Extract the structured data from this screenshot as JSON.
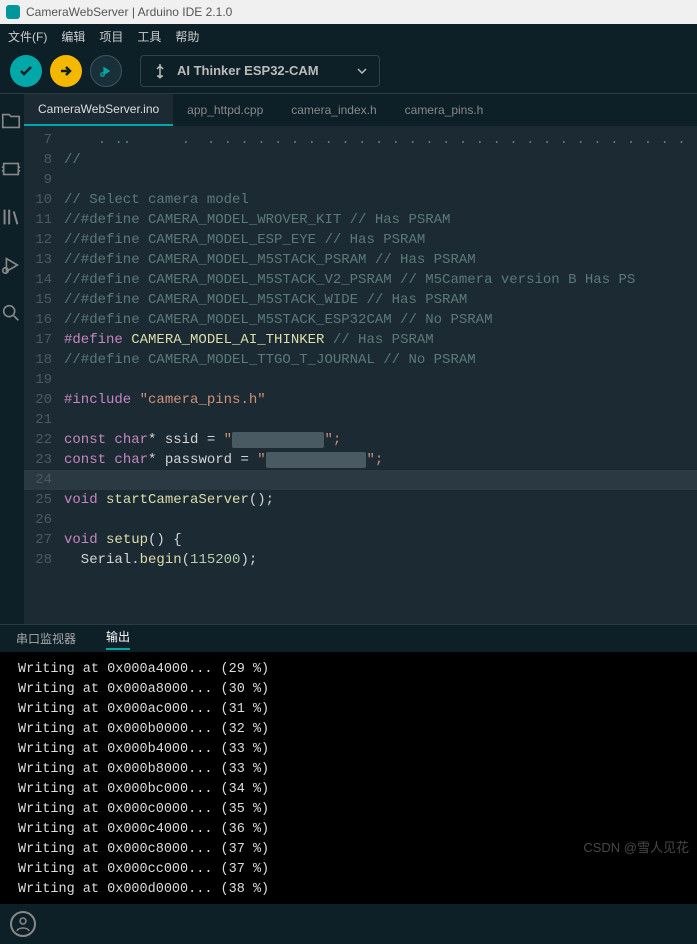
{
  "title": "CameraWebServer | Arduino IDE 2.1.0",
  "menu": {
    "file": "文件(F)",
    "edit": "编辑",
    "project": "项目",
    "tools": "工具",
    "help": "帮助"
  },
  "board": "AI Thinker ESP32-CAM",
  "tabs": [
    {
      "label": "CameraWebServer.ino",
      "active": true
    },
    {
      "label": "app_httpd.cpp",
      "active": false
    },
    {
      "label": "camera_index.h",
      "active": false
    },
    {
      "label": "camera_pins.h",
      "active": false
    }
  ],
  "code": {
    "l7": "    . ..      .  . . . . . . . . . . . . . . . . . . . . . . . . . . . . . . . . . ",
    "l8": "//",
    "l10": "// Select camera model",
    "l11": "//#define CAMERA_MODEL_WROVER_KIT // Has PSRAM",
    "l12": "//#define CAMERA_MODEL_ESP_EYE // Has PSRAM",
    "l13": "//#define CAMERA_MODEL_M5STACK_PSRAM // Has PSRAM",
    "l14": "//#define CAMERA_MODEL_M5STACK_V2_PSRAM // M5Camera version B Has PS",
    "l15": "//#define CAMERA_MODEL_M5STACK_WIDE // Has PSRAM",
    "l16": "//#define CAMERA_MODEL_M5STACK_ESP32CAM // No PSRAM",
    "l17a": "#define ",
    "l17b": "CAMERA_MODEL_AI_THINKER",
    "l17c": " // Has PSRAM",
    "l18": "//#define CAMERA_MODEL_TTGO_T_JOURNAL // No PSRAM",
    "l20a": "#include ",
    "l20b": "\"camera_pins.h\"",
    "l22a": "const ",
    "l22b": "char",
    "l22c": "* ssid = ",
    "l22d": "\"",
    "l22e": "           ",
    "l22f": "\";",
    "l23a": "const ",
    "l23b": "char",
    "l23c": "* password = ",
    "l23d": "\"",
    "l23e": "            ",
    "l23f": "\";",
    "l25a": "void ",
    "l25b": "startCameraServer",
    "l25c": "();",
    "l27a": "void ",
    "l27b": "setup",
    "l27c": "() {",
    "l28a": "  Serial.",
    "l28b": "begin",
    "l28c": "(",
    "l28d": "115200",
    "l28e": ");"
  },
  "panel": {
    "serial": "串口监视器",
    "output": "输出"
  },
  "output_lines": [
    "Writing at 0x000a4000... (29 %)",
    "Writing at 0x000a8000... (30 %)",
    "Writing at 0x000ac000... (31 %)",
    "Writing at 0x000b0000... (32 %)",
    "Writing at 0x000b4000... (33 %)",
    "Writing at 0x000b8000... (33 %)",
    "Writing at 0x000bc000... (34 %)",
    "Writing at 0x000c0000... (35 %)",
    "Writing at 0x000c4000... (36 %)",
    "Writing at 0x000c8000... (37 %)",
    "Writing at 0x000cc000... (37 %)",
    "Writing at 0x000d0000... (38 %)"
  ],
  "watermark": "CSDN @雪人见花"
}
